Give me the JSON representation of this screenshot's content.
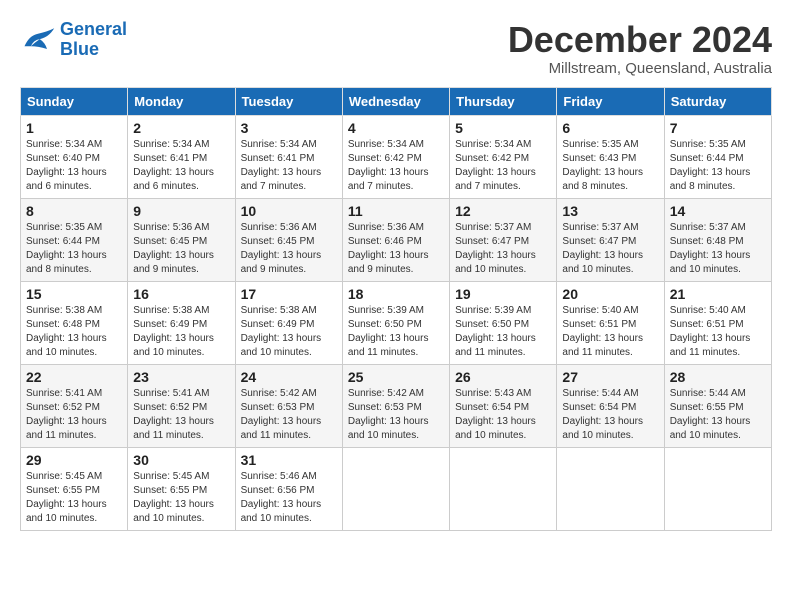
{
  "header": {
    "logo_line1": "General",
    "logo_line2": "Blue",
    "title": "December 2024",
    "location": "Millstream, Queensland, Australia"
  },
  "weekdays": [
    "Sunday",
    "Monday",
    "Tuesday",
    "Wednesday",
    "Thursday",
    "Friday",
    "Saturday"
  ],
  "weeks": [
    [
      {
        "day": "1",
        "info": "Sunrise: 5:34 AM\nSunset: 6:40 PM\nDaylight: 13 hours\nand 6 minutes."
      },
      {
        "day": "2",
        "info": "Sunrise: 5:34 AM\nSunset: 6:41 PM\nDaylight: 13 hours\nand 6 minutes."
      },
      {
        "day": "3",
        "info": "Sunrise: 5:34 AM\nSunset: 6:41 PM\nDaylight: 13 hours\nand 7 minutes."
      },
      {
        "day": "4",
        "info": "Sunrise: 5:34 AM\nSunset: 6:42 PM\nDaylight: 13 hours\nand 7 minutes."
      },
      {
        "day": "5",
        "info": "Sunrise: 5:34 AM\nSunset: 6:42 PM\nDaylight: 13 hours\nand 7 minutes."
      },
      {
        "day": "6",
        "info": "Sunrise: 5:35 AM\nSunset: 6:43 PM\nDaylight: 13 hours\nand 8 minutes."
      },
      {
        "day": "7",
        "info": "Sunrise: 5:35 AM\nSunset: 6:44 PM\nDaylight: 13 hours\nand 8 minutes."
      }
    ],
    [
      {
        "day": "8",
        "info": "Sunrise: 5:35 AM\nSunset: 6:44 PM\nDaylight: 13 hours\nand 8 minutes."
      },
      {
        "day": "9",
        "info": "Sunrise: 5:36 AM\nSunset: 6:45 PM\nDaylight: 13 hours\nand 9 minutes."
      },
      {
        "day": "10",
        "info": "Sunrise: 5:36 AM\nSunset: 6:45 PM\nDaylight: 13 hours\nand 9 minutes."
      },
      {
        "day": "11",
        "info": "Sunrise: 5:36 AM\nSunset: 6:46 PM\nDaylight: 13 hours\nand 9 minutes."
      },
      {
        "day": "12",
        "info": "Sunrise: 5:37 AM\nSunset: 6:47 PM\nDaylight: 13 hours\nand 10 minutes."
      },
      {
        "day": "13",
        "info": "Sunrise: 5:37 AM\nSunset: 6:47 PM\nDaylight: 13 hours\nand 10 minutes."
      },
      {
        "day": "14",
        "info": "Sunrise: 5:37 AM\nSunset: 6:48 PM\nDaylight: 13 hours\nand 10 minutes."
      }
    ],
    [
      {
        "day": "15",
        "info": "Sunrise: 5:38 AM\nSunset: 6:48 PM\nDaylight: 13 hours\nand 10 minutes."
      },
      {
        "day": "16",
        "info": "Sunrise: 5:38 AM\nSunset: 6:49 PM\nDaylight: 13 hours\nand 10 minutes."
      },
      {
        "day": "17",
        "info": "Sunrise: 5:38 AM\nSunset: 6:49 PM\nDaylight: 13 hours\nand 10 minutes."
      },
      {
        "day": "18",
        "info": "Sunrise: 5:39 AM\nSunset: 6:50 PM\nDaylight: 13 hours\nand 11 minutes."
      },
      {
        "day": "19",
        "info": "Sunrise: 5:39 AM\nSunset: 6:50 PM\nDaylight: 13 hours\nand 11 minutes."
      },
      {
        "day": "20",
        "info": "Sunrise: 5:40 AM\nSunset: 6:51 PM\nDaylight: 13 hours\nand 11 minutes."
      },
      {
        "day": "21",
        "info": "Sunrise: 5:40 AM\nSunset: 6:51 PM\nDaylight: 13 hours\nand 11 minutes."
      }
    ],
    [
      {
        "day": "22",
        "info": "Sunrise: 5:41 AM\nSunset: 6:52 PM\nDaylight: 13 hours\nand 11 minutes."
      },
      {
        "day": "23",
        "info": "Sunrise: 5:41 AM\nSunset: 6:52 PM\nDaylight: 13 hours\nand 11 minutes."
      },
      {
        "day": "24",
        "info": "Sunrise: 5:42 AM\nSunset: 6:53 PM\nDaylight: 13 hours\nand 11 minutes."
      },
      {
        "day": "25",
        "info": "Sunrise: 5:42 AM\nSunset: 6:53 PM\nDaylight: 13 hours\nand 10 minutes."
      },
      {
        "day": "26",
        "info": "Sunrise: 5:43 AM\nSunset: 6:54 PM\nDaylight: 13 hours\nand 10 minutes."
      },
      {
        "day": "27",
        "info": "Sunrise: 5:44 AM\nSunset: 6:54 PM\nDaylight: 13 hours\nand 10 minutes."
      },
      {
        "day": "28",
        "info": "Sunrise: 5:44 AM\nSunset: 6:55 PM\nDaylight: 13 hours\nand 10 minutes."
      }
    ],
    [
      {
        "day": "29",
        "info": "Sunrise: 5:45 AM\nSunset: 6:55 PM\nDaylight: 13 hours\nand 10 minutes."
      },
      {
        "day": "30",
        "info": "Sunrise: 5:45 AM\nSunset: 6:55 PM\nDaylight: 13 hours\nand 10 minutes."
      },
      {
        "day": "31",
        "info": "Sunrise: 5:46 AM\nSunset: 6:56 PM\nDaylight: 13 hours\nand 10 minutes."
      },
      {
        "day": "",
        "info": ""
      },
      {
        "day": "",
        "info": ""
      },
      {
        "day": "",
        "info": ""
      },
      {
        "day": "",
        "info": ""
      }
    ]
  ]
}
